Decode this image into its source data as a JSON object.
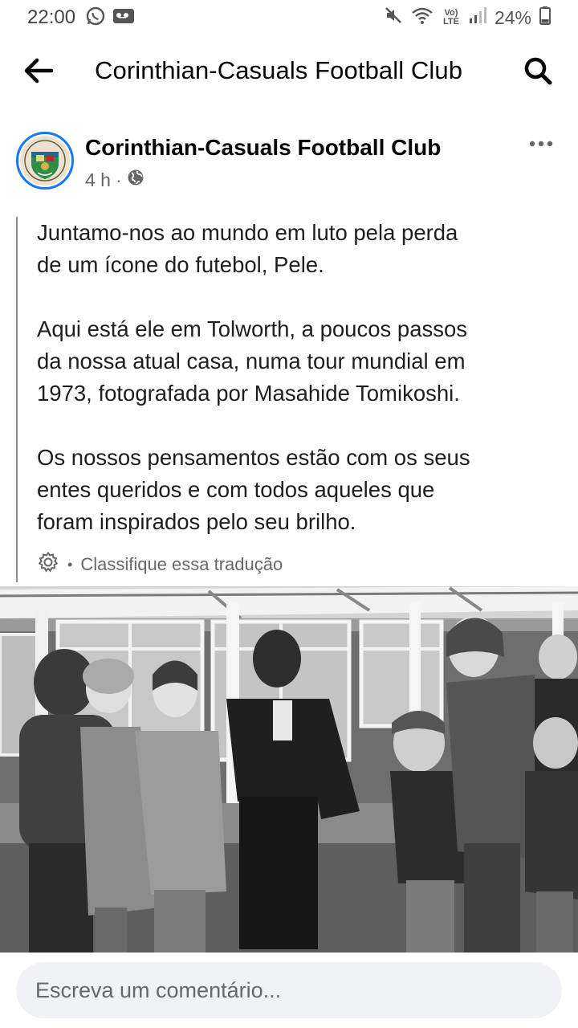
{
  "status_bar": {
    "time": "22:00",
    "signal_tags": "Vo) LTE",
    "battery": "24%"
  },
  "header": {
    "title": "Corinthian-Casuals Football Club"
  },
  "post": {
    "page_name": "Corinthian-Casuals Football Club",
    "time_ago": "4 h",
    "separator": "·",
    "text": "Juntamo-nos ao mundo em luto pela perda\nde um ícone do futebol, Pele.\n\nAqui está ele em Tolworth, a poucos passos\nda nossa atual casa, numa tour mundial em\n1973, fotografada por Masahide Tomikoshi.\n\nOs nossos pensamentos estão com os seus\nentes queridos e com todos aqueles que\nforam inspirados pelo seu brilho.",
    "rate_translation": "Classifique essa tradução",
    "rate_dot": "•"
  },
  "comment": {
    "placeholder": "Escreva um comentário..."
  },
  "icons": {
    "back": "arrow-left-icon",
    "search": "search-icon",
    "more": "more-dots-icon",
    "globe": "globe-icon",
    "gear": "gear-icon"
  },
  "colors": {
    "accent": "#1877f2",
    "secondary_text": "#65676b",
    "comment_bg": "#f0f2f5"
  }
}
